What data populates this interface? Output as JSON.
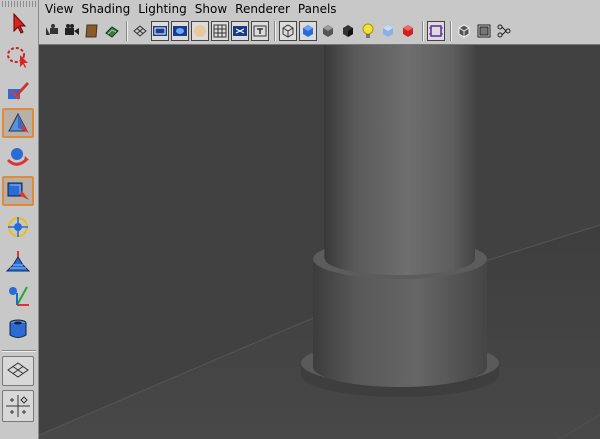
{
  "menubar": {
    "items": [
      "View",
      "Shading",
      "Lighting",
      "Show",
      "Renderer",
      "Panels"
    ]
  },
  "iconbar": {
    "icons": [
      "select-camera-icon",
      "camera-attributes-icon",
      "bookmarks-icon",
      "image-plane-icon",
      "wireframe-smooth-icon",
      "film-gate-icon",
      "resolution-gate-icon",
      "field-chart-icon",
      "safe-action-icon",
      "grid-icon",
      "xray-icon",
      "text-display-icon",
      "wireframe-cube-icon",
      "smooth-shade-cube-icon",
      "flat-shade-cube-icon",
      "bounding-box-icon",
      "default-lighting-icon",
      "textured-icon",
      "shadows-icon",
      "isolate-select-icon",
      "wireframe-on-shaded-icon",
      "frame-all-icon",
      "hypershade-icon"
    ]
  },
  "toolbox": {
    "tools": [
      {
        "name": "select-tool-icon",
        "active": false
      },
      {
        "name": "lasso-tool-icon",
        "active": false
      },
      {
        "name": "paint-select-tool-icon",
        "active": false
      },
      {
        "name": "move-tool-icon",
        "active": true
      },
      {
        "name": "rotate-tool-icon",
        "active": false
      },
      {
        "name": "scale-tool-icon",
        "active": true
      },
      {
        "name": "universal-manipulator-icon",
        "active": false
      },
      {
        "name": "soft-modification-icon",
        "active": false
      },
      {
        "name": "show-manipulator-icon",
        "active": false
      },
      {
        "name": "last-used-tool-icon",
        "active": false
      },
      {
        "name": "single-perspective-layout-icon",
        "active": false
      },
      {
        "name": "four-view-layout-icon",
        "active": false
      }
    ]
  },
  "colors": {
    "accent": "#e08a3c",
    "viewport_bg": "#444444",
    "object_shade": "#666666"
  }
}
